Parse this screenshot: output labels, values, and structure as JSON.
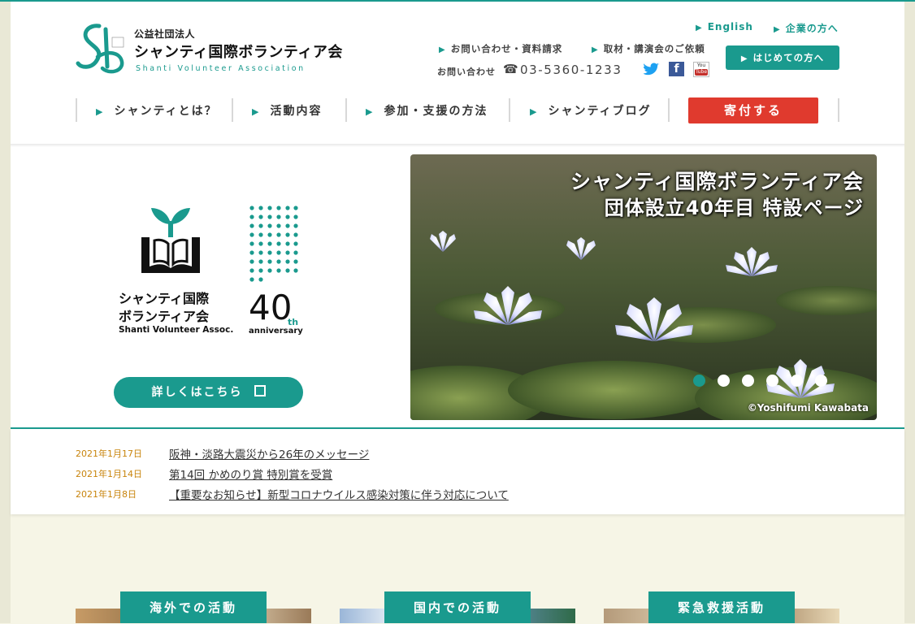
{
  "logo": {
    "corp": "公益社団法人",
    "name": "シャンティ国際ボランティア会",
    "name_en": "Shanti Volunteer Association"
  },
  "header": {
    "english": "English",
    "corporate": "企業の方へ",
    "inquiry": "お問い合わせ・資料請求",
    "media": "取材・講演会のご依頼",
    "contact_label": "お問い合わせ",
    "phone": "03-5360-1233",
    "first_time": "はじめての方へ"
  },
  "nav": {
    "items": [
      {
        "label": "シャンティとは？"
      },
      {
        "label": "活動内容"
      },
      {
        "label": "参加・支援の方法"
      },
      {
        "label": "シャンティブログ"
      }
    ],
    "donate": "寄付する"
  },
  "hero": {
    "emblem": {
      "jp_line1": "シャンティ国際",
      "jp_line2": "ボランティア会",
      "en": "Shanti Volunteer Assoc.",
      "num": "40",
      "th": "th",
      "anniversary": "anniversary"
    },
    "more_button": "詳しくはこちら",
    "slide": {
      "title_line1": "シャンティ国際ボランティア会",
      "title_line2": "団体設立40年目 特設ページ",
      "credit": "©Yoshifumi Kawabata",
      "slide_count": 6,
      "active_index": 0
    }
  },
  "news": [
    {
      "date": "2021年1月17日",
      "title": "阪神・淡路大震災から26年のメッセージ"
    },
    {
      "date": "2021年1月14日",
      "title": "第14回 かめのり賞 特別賞を受賞"
    },
    {
      "date": "2021年1月8日",
      "title": "【重要なお知らせ】新型コロナウイルス感染対策に伴う対応について"
    }
  ],
  "activities": [
    {
      "label": "海外での活動"
    },
    {
      "label": "国内での活動"
    },
    {
      "label": "緊急救援活動"
    }
  ],
  "colors": {
    "accent": "#1a9a8e",
    "donate": "#e03a2e",
    "date": "#c8840c",
    "background": "#f6f5e6"
  }
}
